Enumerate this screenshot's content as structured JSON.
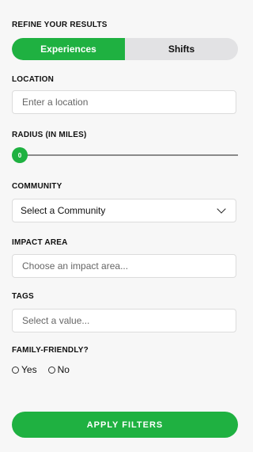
{
  "refine": {
    "title": "REFINE YOUR RESULTS",
    "tabs": [
      {
        "label": "Experiences",
        "active": true
      },
      {
        "label": "Shifts",
        "active": false
      }
    ]
  },
  "location": {
    "label": "LOCATION",
    "placeholder": "Enter a location",
    "value": ""
  },
  "radius": {
    "label": "RADIUS (IN MILES)",
    "value": "0"
  },
  "community": {
    "label": "COMMUNITY",
    "selected": "Select a Community"
  },
  "impact_area": {
    "label": "IMPACT AREA",
    "placeholder": "Choose an impact area..."
  },
  "tags": {
    "label": "TAGS",
    "placeholder": "Select a value..."
  },
  "family_friendly": {
    "label": "FAMILY-FRIENDLY?",
    "options": [
      "Yes",
      "No"
    ]
  },
  "apply_button": {
    "label": "APPLY FILTERS"
  },
  "colors": {
    "accent": "#1fb141",
    "toggle_bg": "#e2e2e4",
    "page_bg": "#f7f7f7"
  },
  "icons": {
    "community_dropdown": "chevron-down-icon",
    "radius_slider": "slider-knob"
  }
}
